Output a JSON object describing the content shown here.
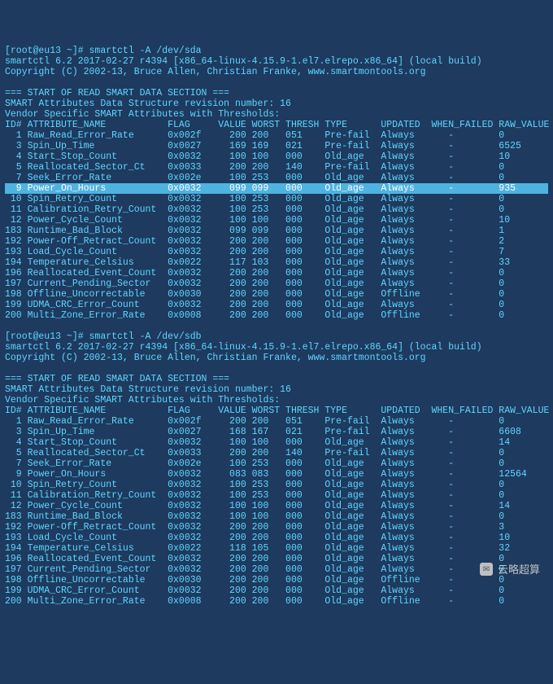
{
  "blocks": [
    {
      "prompt": "[root@eu13 ~]# ",
      "command": "smartctl -A /dev/sda",
      "version_line": "smartctl 6.2 2017-02-27 r4394 [x86_64-linux-4.15.9-1.el7.elrepo.x86_64] (local build)",
      "copyright_line": "Copyright (C) 2002-13, Bruce Allen, Christian Franke, www.smartmontools.org",
      "section_start": "=== START OF READ SMART DATA SECTION ===",
      "revision_line": "SMART Attributes Data Structure revision number: 16",
      "vendor_line": "Vendor Specific SMART Attributes with Thresholds:",
      "header": {
        "id": "ID#",
        "name": "ATTRIBUTE_NAME",
        "flag": "FLAG",
        "value": "VALUE",
        "worst": "WORST",
        "thresh": "THRESH",
        "type": "TYPE",
        "updated": "UPDATED",
        "when_failed": "WHEN_FAILED",
        "raw": "RAW_VALUE"
      },
      "rows": [
        {
          "id": "1",
          "name": "Raw_Read_Error_Rate",
          "flag": "0x002f",
          "value": "200",
          "worst": "200",
          "thresh": "051",
          "type": "Pre-fail",
          "updated": "Always",
          "when_failed": "-",
          "raw": "0"
        },
        {
          "id": "3",
          "name": "Spin_Up_Time",
          "flag": "0x0027",
          "value": "169",
          "worst": "169",
          "thresh": "021",
          "type": "Pre-fail",
          "updated": "Always",
          "when_failed": "-",
          "raw": "6525"
        },
        {
          "id": "4",
          "name": "Start_Stop_Count",
          "flag": "0x0032",
          "value": "100",
          "worst": "100",
          "thresh": "000",
          "type": "Old_age",
          "updated": "Always",
          "when_failed": "-",
          "raw": "10"
        },
        {
          "id": "5",
          "name": "Reallocated_Sector_Ct",
          "flag": "0x0033",
          "value": "200",
          "worst": "200",
          "thresh": "140",
          "type": "Pre-fail",
          "updated": "Always",
          "when_failed": "-",
          "raw": "0"
        },
        {
          "id": "7",
          "name": "Seek_Error_Rate",
          "flag": "0x002e",
          "value": "100",
          "worst": "253",
          "thresh": "000",
          "type": "Old_age",
          "updated": "Always",
          "when_failed": "-",
          "raw": "0"
        },
        {
          "id": "9",
          "name": "Power_On_Hours",
          "flag": "0x0032",
          "value": "099",
          "worst": "099",
          "thresh": "000",
          "type": "Old_age",
          "updated": "Always",
          "when_failed": "-",
          "raw": "935",
          "hl": true
        },
        {
          "id": "10",
          "name": "Spin_Retry_Count",
          "flag": "0x0032",
          "value": "100",
          "worst": "253",
          "thresh": "000",
          "type": "Old_age",
          "updated": "Always",
          "when_failed": "-",
          "raw": "0"
        },
        {
          "id": "11",
          "name": "Calibration_Retry_Count",
          "flag": "0x0032",
          "value": "100",
          "worst": "253",
          "thresh": "000",
          "type": "Old_age",
          "updated": "Always",
          "when_failed": "-",
          "raw": "0"
        },
        {
          "id": "12",
          "name": "Power_Cycle_Count",
          "flag": "0x0032",
          "value": "100",
          "worst": "100",
          "thresh": "000",
          "type": "Old_age",
          "updated": "Always",
          "when_failed": "-",
          "raw": "10"
        },
        {
          "id": "183",
          "name": "Runtime_Bad_Block",
          "flag": "0x0032",
          "value": "099",
          "worst": "099",
          "thresh": "000",
          "type": "Old_age",
          "updated": "Always",
          "when_failed": "-",
          "raw": "1"
        },
        {
          "id": "192",
          "name": "Power-Off_Retract_Count",
          "flag": "0x0032",
          "value": "200",
          "worst": "200",
          "thresh": "000",
          "type": "Old_age",
          "updated": "Always",
          "when_failed": "-",
          "raw": "2"
        },
        {
          "id": "193",
          "name": "Load_Cycle_Count",
          "flag": "0x0032",
          "value": "200",
          "worst": "200",
          "thresh": "000",
          "type": "Old_age",
          "updated": "Always",
          "when_failed": "-",
          "raw": "7"
        },
        {
          "id": "194",
          "name": "Temperature_Celsius",
          "flag": "0x0022",
          "value": "117",
          "worst": "103",
          "thresh": "000",
          "type": "Old_age",
          "updated": "Always",
          "when_failed": "-",
          "raw": "33"
        },
        {
          "id": "196",
          "name": "Reallocated_Event_Count",
          "flag": "0x0032",
          "value": "200",
          "worst": "200",
          "thresh": "000",
          "type": "Old_age",
          "updated": "Always",
          "when_failed": "-",
          "raw": "0"
        },
        {
          "id": "197",
          "name": "Current_Pending_Sector",
          "flag": "0x0032",
          "value": "200",
          "worst": "200",
          "thresh": "000",
          "type": "Old_age",
          "updated": "Always",
          "when_failed": "-",
          "raw": "0"
        },
        {
          "id": "198",
          "name": "Offline_Uncorrectable",
          "flag": "0x0030",
          "value": "200",
          "worst": "200",
          "thresh": "000",
          "type": "Old_age",
          "updated": "Offline",
          "when_failed": "-",
          "raw": "0"
        },
        {
          "id": "199",
          "name": "UDMA_CRC_Error_Count",
          "flag": "0x0032",
          "value": "200",
          "worst": "200",
          "thresh": "000",
          "type": "Old_age",
          "updated": "Always",
          "when_failed": "-",
          "raw": "0"
        },
        {
          "id": "200",
          "name": "Multi_Zone_Error_Rate",
          "flag": "0x0008",
          "value": "200",
          "worst": "200",
          "thresh": "000",
          "type": "Old_age",
          "updated": "Offline",
          "when_failed": "-",
          "raw": "0"
        }
      ]
    },
    {
      "prompt": "[root@eu13 ~]# ",
      "command": "smartctl -A /dev/sdb",
      "version_line": "smartctl 6.2 2017-02-27 r4394 [x86_64-linux-4.15.9-1.el7.elrepo.x86_64] (local build)",
      "copyright_line": "Copyright (C) 2002-13, Bruce Allen, Christian Franke, www.smartmontools.org",
      "section_start": "=== START OF READ SMART DATA SECTION ===",
      "revision_line": "SMART Attributes Data Structure revision number: 16",
      "vendor_line": "Vendor Specific SMART Attributes with Thresholds:",
      "header": {
        "id": "ID#",
        "name": "ATTRIBUTE_NAME",
        "flag": "FLAG",
        "value": "VALUE",
        "worst": "WORST",
        "thresh": "THRESH",
        "type": "TYPE",
        "updated": "UPDATED",
        "when_failed": "WHEN_FAILED",
        "raw": "RAW_VALUE"
      },
      "rows": [
        {
          "id": "1",
          "name": "Raw_Read_Error_Rate",
          "flag": "0x002f",
          "value": "200",
          "worst": "200",
          "thresh": "051",
          "type": "Pre-fail",
          "updated": "Always",
          "when_failed": "-",
          "raw": "0"
        },
        {
          "id": "3",
          "name": "Spin_Up_Time",
          "flag": "0x0027",
          "value": "168",
          "worst": "167",
          "thresh": "021",
          "type": "Pre-fail",
          "updated": "Always",
          "when_failed": "-",
          "raw": "6608"
        },
        {
          "id": "4",
          "name": "Start_Stop_Count",
          "flag": "0x0032",
          "value": "100",
          "worst": "100",
          "thresh": "000",
          "type": "Old_age",
          "updated": "Always",
          "when_failed": "-",
          "raw": "14"
        },
        {
          "id": "5",
          "name": "Reallocated_Sector_Ct",
          "flag": "0x0033",
          "value": "200",
          "worst": "200",
          "thresh": "140",
          "type": "Pre-fail",
          "updated": "Always",
          "when_failed": "-",
          "raw": "0"
        },
        {
          "id": "7",
          "name": "Seek_Error_Rate",
          "flag": "0x002e",
          "value": "100",
          "worst": "253",
          "thresh": "000",
          "type": "Old_age",
          "updated": "Always",
          "when_failed": "-",
          "raw": "0"
        },
        {
          "id": "9",
          "name": "Power_On_Hours",
          "flag": "0x0032",
          "value": "083",
          "worst": "083",
          "thresh": "000",
          "type": "Old_age",
          "updated": "Always",
          "when_failed": "-",
          "raw": "12564"
        },
        {
          "id": "10",
          "name": "Spin_Retry_Count",
          "flag": "0x0032",
          "value": "100",
          "worst": "253",
          "thresh": "000",
          "type": "Old_age",
          "updated": "Always",
          "when_failed": "-",
          "raw": "0"
        },
        {
          "id": "11",
          "name": "Calibration_Retry_Count",
          "flag": "0x0032",
          "value": "100",
          "worst": "253",
          "thresh": "000",
          "type": "Old_age",
          "updated": "Always",
          "when_failed": "-",
          "raw": "0"
        },
        {
          "id": "12",
          "name": "Power_Cycle_Count",
          "flag": "0x0032",
          "value": "100",
          "worst": "100",
          "thresh": "000",
          "type": "Old_age",
          "updated": "Always",
          "when_failed": "-",
          "raw": "14"
        },
        {
          "id": "183",
          "name": "Runtime_Bad_Block",
          "flag": "0x0032",
          "value": "100",
          "worst": "100",
          "thresh": "000",
          "type": "Old_age",
          "updated": "Always",
          "when_failed": "-",
          "raw": "0"
        },
        {
          "id": "192",
          "name": "Power-Off_Retract_Count",
          "flag": "0x0032",
          "value": "200",
          "worst": "200",
          "thresh": "000",
          "type": "Old_age",
          "updated": "Always",
          "when_failed": "-",
          "raw": "3"
        },
        {
          "id": "193",
          "name": "Load_Cycle_Count",
          "flag": "0x0032",
          "value": "200",
          "worst": "200",
          "thresh": "000",
          "type": "Old_age",
          "updated": "Always",
          "when_failed": "-",
          "raw": "10"
        },
        {
          "id": "194",
          "name": "Temperature_Celsius",
          "flag": "0x0022",
          "value": "118",
          "worst": "105",
          "thresh": "000",
          "type": "Old_age",
          "updated": "Always",
          "when_failed": "-",
          "raw": "32"
        },
        {
          "id": "196",
          "name": "Reallocated_Event_Count",
          "flag": "0x0032",
          "value": "200",
          "worst": "200",
          "thresh": "000",
          "type": "Old_age",
          "updated": "Always",
          "when_failed": "-",
          "raw": "0"
        },
        {
          "id": "197",
          "name": "Current_Pending_Sector",
          "flag": "0x0032",
          "value": "200",
          "worst": "200",
          "thresh": "000",
          "type": "Old_age",
          "updated": "Always",
          "when_failed": "-",
          "raw": "0"
        },
        {
          "id": "198",
          "name": "Offline_Uncorrectable",
          "flag": "0x0030",
          "value": "200",
          "worst": "200",
          "thresh": "000",
          "type": "Old_age",
          "updated": "Offline",
          "when_failed": "-",
          "raw": "0"
        },
        {
          "id": "199",
          "name": "UDMA_CRC_Error_Count",
          "flag": "0x0032",
          "value": "200",
          "worst": "200",
          "thresh": "000",
          "type": "Old_age",
          "updated": "Always",
          "when_failed": "-",
          "raw": "0"
        },
        {
          "id": "200",
          "name": "Multi_Zone_Error_Rate",
          "flag": "0x0008",
          "value": "200",
          "worst": "200",
          "thresh": "000",
          "type": "Old_age",
          "updated": "Offline",
          "when_failed": "-",
          "raw": "0"
        }
      ]
    }
  ],
  "watermark": "云略超算"
}
